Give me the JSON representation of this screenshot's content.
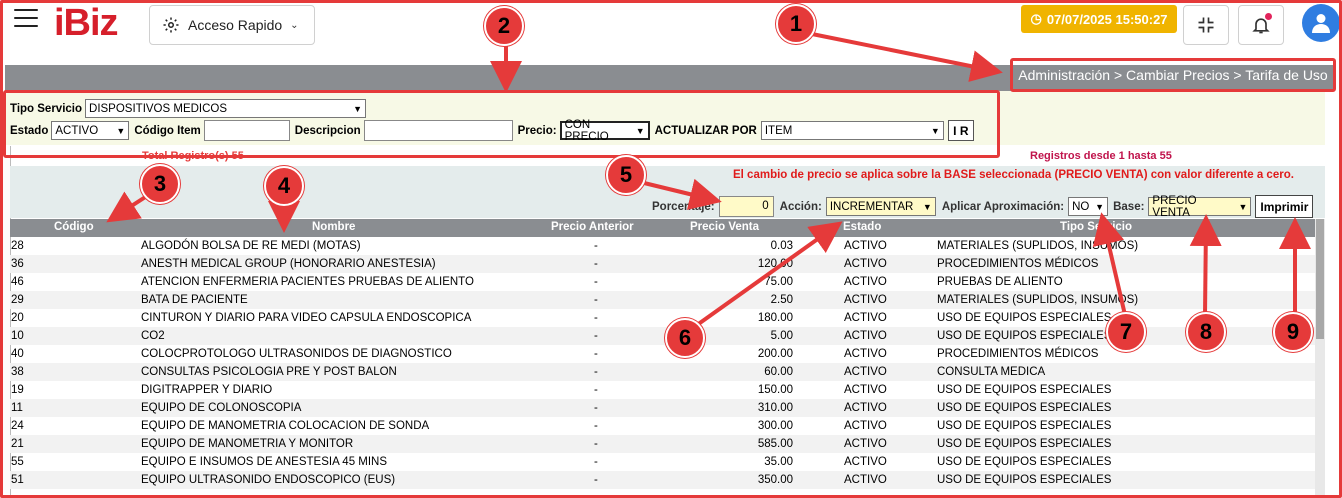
{
  "header": {
    "logo": "iBiz",
    "quick_access": "Acceso Rapido",
    "datetime": "07/07/2025 15:50:27"
  },
  "breadcrumb": "Administración > Cambiar Precios > Tarifa de Uso",
  "filters": {
    "tipo_servicio_label": "Tipo Servicio",
    "tipo_servicio_value": "DISPOSITIVOS MEDICOS",
    "estado_label": "Estado",
    "estado_value": "ACTIVO",
    "codigo_label": "Código Item",
    "codigo_value": "",
    "descripcion_label": "Descripcion",
    "descripcion_value": "",
    "precio_label": "Precio:",
    "precio_value": "CON PRECIO",
    "actualizar_label": "ACTUALIZAR POR",
    "actualizar_value": "ITEM",
    "ir_label": "I R"
  },
  "results": {
    "total": "Total Registro(s) 55",
    "range": "Registros desde 1 hasta 55",
    "notice": "El cambio de precio se aplica sobre la BASE seleccionada (PRECIO VENTA) con valor diferente a cero."
  },
  "controls": {
    "porcentaje_label": "Porcentaje:",
    "porcentaje_value": "0",
    "accion_label": "Acción:",
    "accion_value": "INCREMENTAR",
    "aprox_label": "Aplicar Aproximación:",
    "aprox_value": "NO",
    "base_label": "Base:",
    "base_value": "PRECIO VENTA",
    "print_label": "Imprimir"
  },
  "table": {
    "columns": [
      "Código",
      "Nombre",
      "Precio Anterior",
      "Precio Venta",
      "Estado",
      "Tipo Servicio"
    ],
    "rows": [
      [
        "28",
        "ALGODÓN BOLSA DE RE MEDI (MOTAS)",
        "-",
        "0.03",
        "ACTIVO",
        "MATERIALES (SUPLIDOS, INSUMOS)"
      ],
      [
        "36",
        "ANESTH MEDICAL GROUP (HONORARIO ANESTESIA)",
        "-",
        "120.00",
        "ACTIVO",
        "PROCEDIMIENTOS MÉDICOS"
      ],
      [
        "46",
        "ATENCION ENFERMERIA PACIENTES PRUEBAS DE ALIENTO",
        "-",
        "75.00",
        "ACTIVO",
        "PRUEBAS DE ALIENTO"
      ],
      [
        "29",
        "BATA DE PACIENTE",
        "-",
        "2.50",
        "ACTIVO",
        "MATERIALES (SUPLIDOS, INSUMOS)"
      ],
      [
        "20",
        "CINTURON Y DIARIO PARA VIDEO CAPSULA ENDOSCOPICA",
        "-",
        "180.00",
        "ACTIVO",
        "USO DE EQUIPOS ESPECIALES"
      ],
      [
        "10",
        "CO2",
        "-",
        "5.00",
        "ACTIVO",
        "USO DE EQUIPOS ESPECIALES"
      ],
      [
        "40",
        "COLOCPROTOLOGO ULTRASONIDOS DE DIAGNOSTICO",
        "-",
        "200.00",
        "ACTIVO",
        "PROCEDIMIENTOS MÉDICOS"
      ],
      [
        "38",
        "CONSULTAS PSICOLOGIA PRE Y POST BALON",
        "-",
        "60.00",
        "ACTIVO",
        "CONSULTA MEDICA"
      ],
      [
        "19",
        "DIGITRAPPER Y DIARIO",
        "-",
        "150.00",
        "ACTIVO",
        "USO DE EQUIPOS ESPECIALES"
      ],
      [
        "11",
        "EQUIPO DE COLONOSCOPIA",
        "-",
        "310.00",
        "ACTIVO",
        "USO DE EQUIPOS ESPECIALES"
      ],
      [
        "24",
        "EQUIPO DE MANOMETRIA COLOCACION DE SONDA",
        "-",
        "300.00",
        "ACTIVO",
        "USO DE EQUIPOS ESPECIALES"
      ],
      [
        "21",
        "EQUIPO DE MANOMETRIA Y MONITOR",
        "-",
        "585.00",
        "ACTIVO",
        "USO DE EQUIPOS ESPECIALES"
      ],
      [
        "55",
        "EQUIPO E INSUMOS DE ANESTESIA 45 MINS",
        "-",
        "35.00",
        "ACTIVO",
        "USO DE EQUIPOS ESPECIALES"
      ],
      [
        "51",
        "EQUIPO ULTRASONIDO ENDOSCOPICO (EUS)",
        "-",
        "350.00",
        "ACTIVO",
        "USO DE EQUIPOS ESPECIALES"
      ]
    ]
  },
  "annotations": [
    "1",
    "2",
    "3",
    "4",
    "5",
    "6",
    "7",
    "8",
    "9"
  ],
  "colors": {
    "accent_red": "#e53a3a",
    "badge_yellow": "#f0b400",
    "header_gray": "#8a8d91",
    "avatar_blue": "#2f7de1"
  }
}
